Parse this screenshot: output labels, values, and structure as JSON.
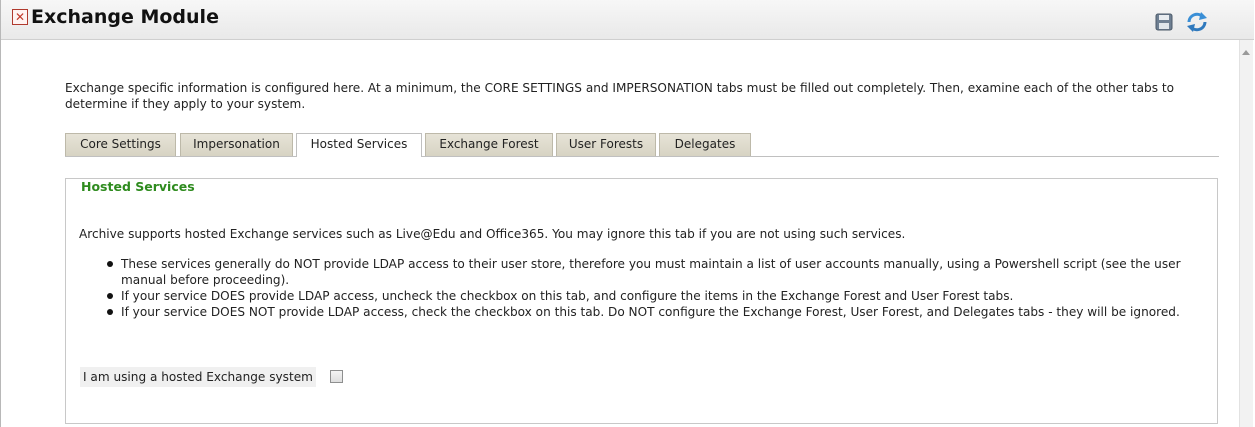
{
  "window": {
    "title": "Exchange Module",
    "icons": [
      "app-icon",
      "save-icon",
      "refresh-icon"
    ]
  },
  "intro": "Exchange specific information is configured here. At a minimum, the CORE SETTINGS and IMPERSONATION tabs must be filled out completely. Then, examine each of the other tabs to determine if they apply to your system.",
  "tabs": [
    {
      "label": "Core Settings"
    },
    {
      "label": "Impersonation"
    },
    {
      "label": "Hosted Services"
    },
    {
      "label": "Exchange Forest"
    },
    {
      "label": "User Forests"
    },
    {
      "label": "Delegates"
    }
  ],
  "active_tab": "Hosted Services",
  "hosted": {
    "legend": "Hosted Services",
    "description": "Archive supports hosted Exchange services such as Live@Edu and Office365. You may ignore this tab if you are not using such services.",
    "bullets": [
      "These services generally do NOT provide LDAP access to their user store, therefore you must maintain a list of user accounts manually, using a Powershell script (see the user manual before proceeding).",
      "If your service DOES provide LDAP access, uncheck the checkbox on this tab, and configure the items in the Exchange Forest and User Forest tabs.",
      "If your service DOES NOT provide LDAP access, check the checkbox on this tab. Do NOT configure the Exchange Forest, User Forest, and Delegates tabs - they will be ignored."
    ],
    "checkbox_label": "I am using a hosted Exchange system",
    "checkbox_checked": false
  },
  "colors": {
    "legend": "#2e8b1e",
    "tab_bg": "#d7d3c3",
    "refresh": "#3a8fd6"
  }
}
